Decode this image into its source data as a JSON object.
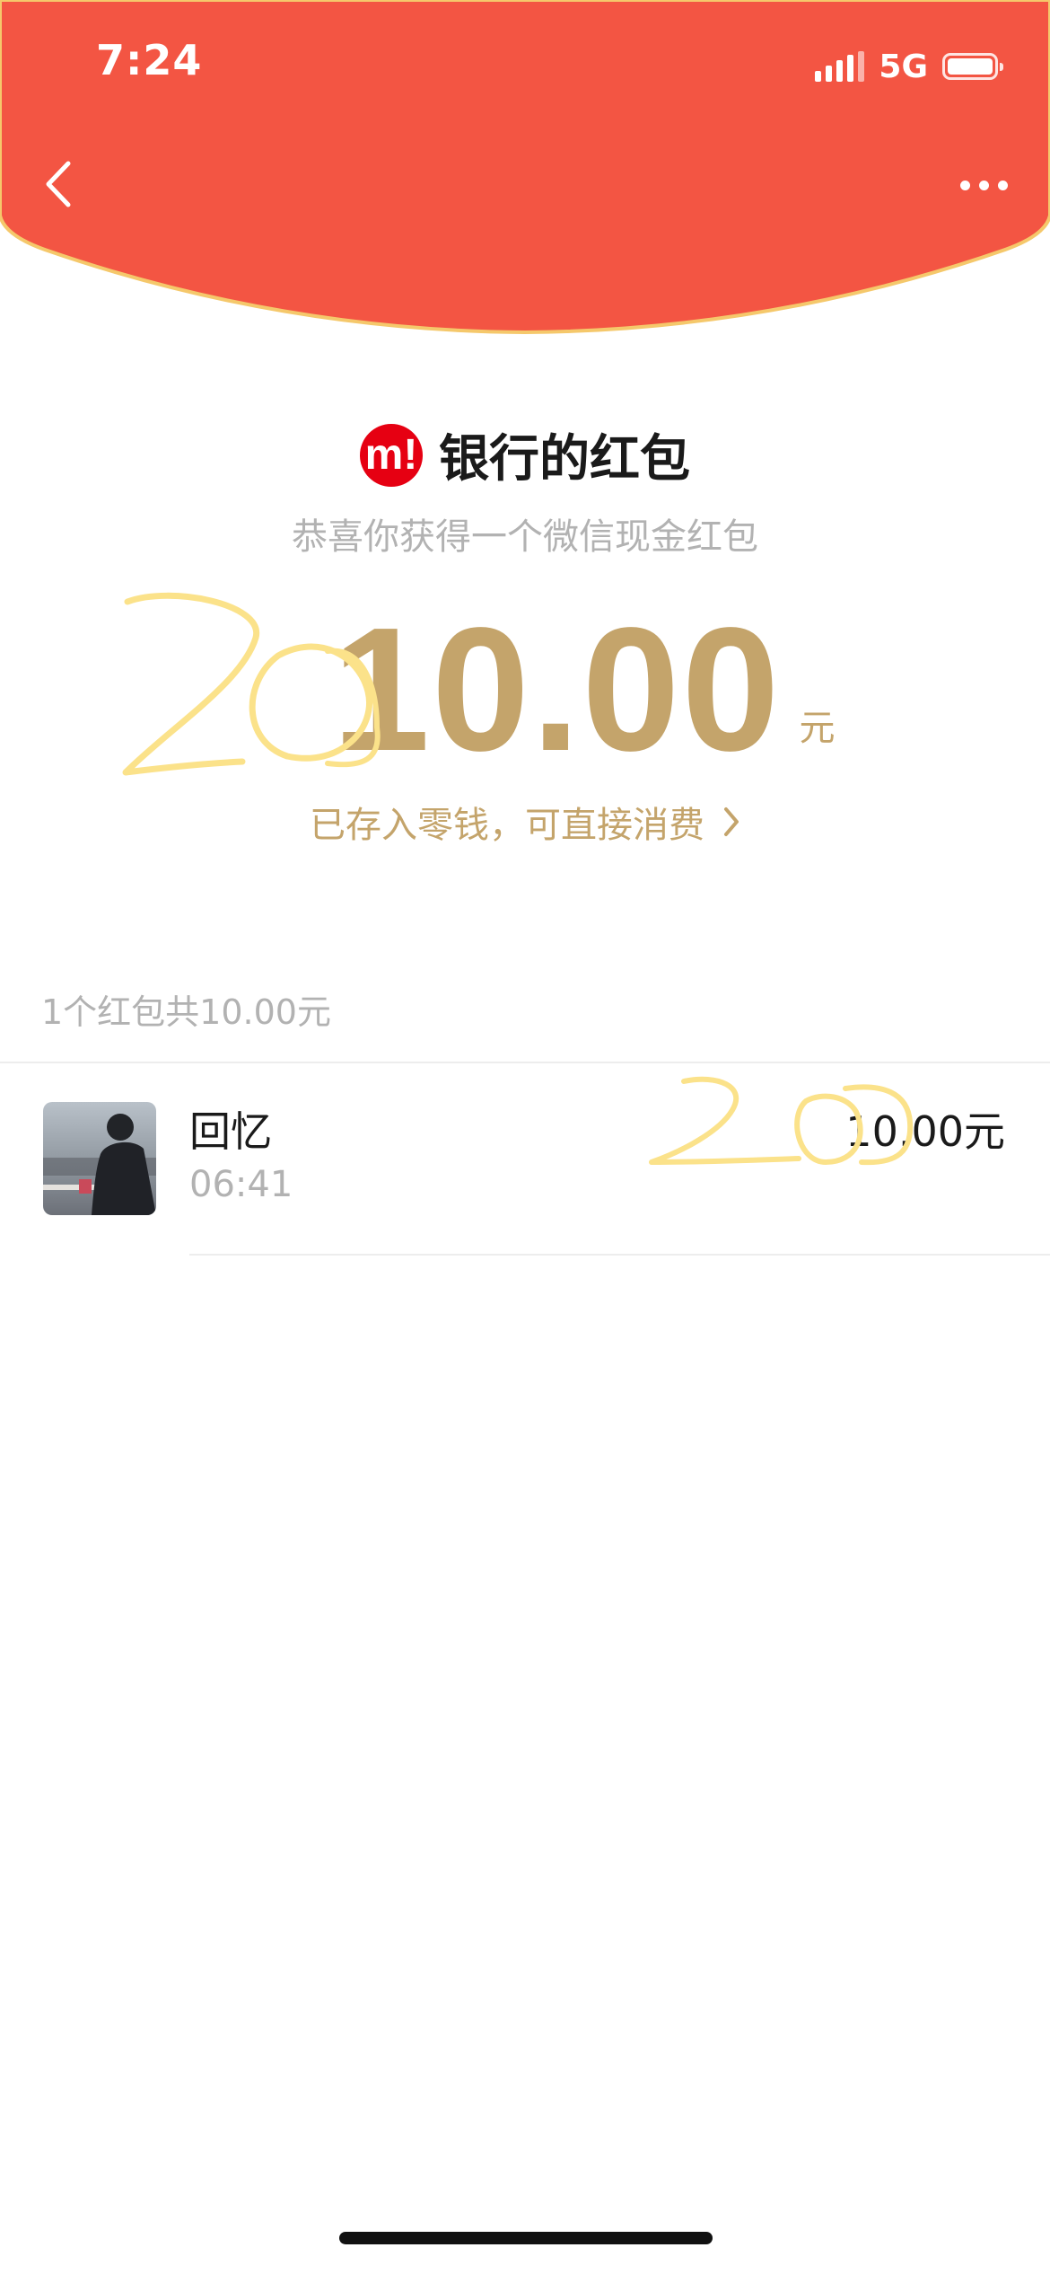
{
  "status_bar": {
    "time": "7:24",
    "network": "5G",
    "signal_icon": "signal-bars-icon",
    "battery_icon": "battery-icon"
  },
  "nav": {
    "back_icon": "chevron-left-icon",
    "more_icon": "more-dots-icon"
  },
  "colors": {
    "header_red": "#f35543",
    "header_rim": "#f5c86b",
    "gold": "#c4a46b",
    "brand_red": "#e60012",
    "scribble_yellow": "#fbe28a"
  },
  "red_packet": {
    "brand_logo": "m!",
    "sender_name": "银行的红包",
    "subtitle": "恭喜你获得一个微信现金红包",
    "amount": "10.00",
    "unit": "元",
    "wallet_link": "已存入零钱，可直接消费"
  },
  "summary": "1个红包共10.00元",
  "records": [
    {
      "name": "回忆",
      "time": "06:41",
      "amount": "10.00元"
    }
  ]
}
